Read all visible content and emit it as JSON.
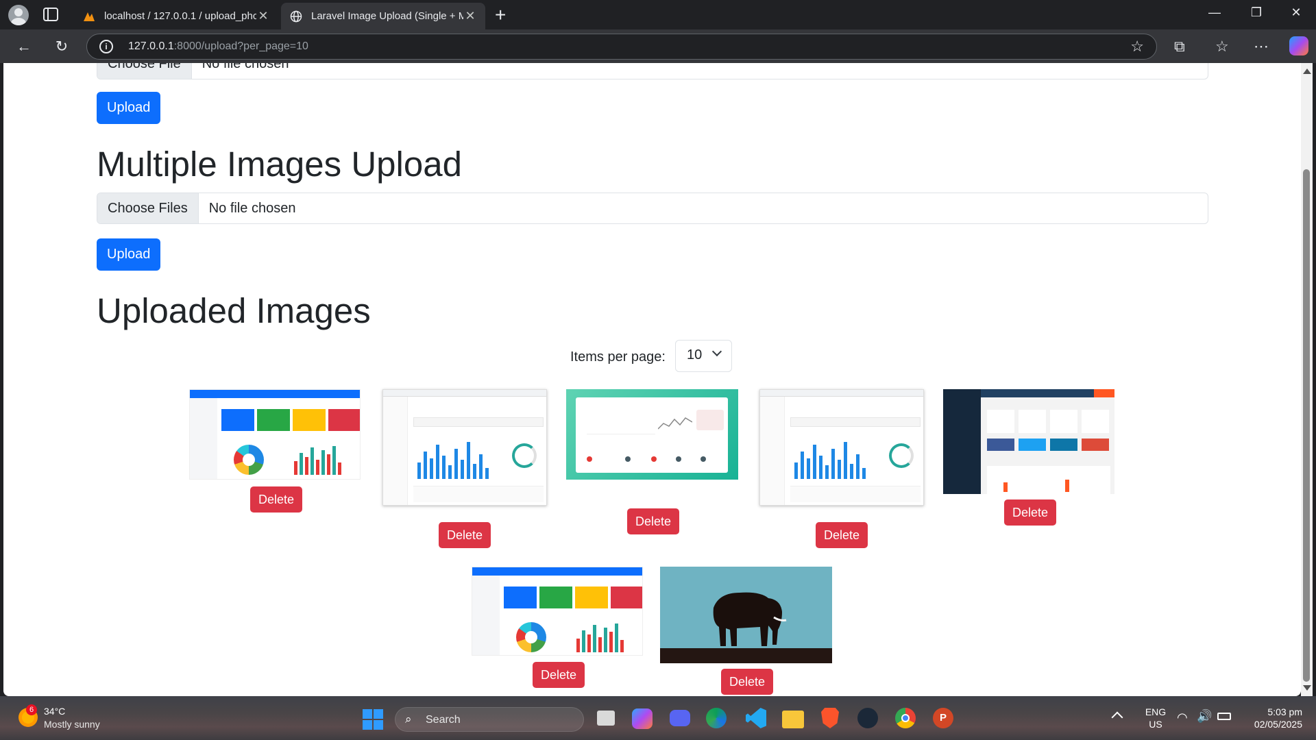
{
  "browser": {
    "tabs": [
      {
        "title": "localhost / 127.0.0.1 / upload_phc",
        "active": false
      },
      {
        "title": "Laravel Image Upload (Single + M",
        "active": true
      }
    ],
    "url_host": "127.0.0.1",
    "url_rest": ":8000/upload?per_page=10"
  },
  "page": {
    "single_upload": {
      "choose_label": "Choose File",
      "status": "No file chosen",
      "button": "Upload"
    },
    "multiple_upload": {
      "heading": "Multiple Images Upload",
      "choose_label": "Choose Files",
      "status": "No file chosen",
      "button": "Upload"
    },
    "uploaded": {
      "heading": "Uploaded Images",
      "per_page_label": "Items per page:",
      "per_page_value": "10",
      "delete_label": "Delete"
    }
  },
  "taskbar": {
    "weather": {
      "temp": "34°C",
      "desc": "Mostly sunny",
      "badge": "6"
    },
    "search_placeholder": "Search",
    "lang": {
      "line1": "ENG",
      "line2": "US"
    },
    "time": "5:03 pm",
    "date": "02/05/2025"
  },
  "colors": {
    "primary": "#0d6efd",
    "danger": "#dc3545"
  }
}
